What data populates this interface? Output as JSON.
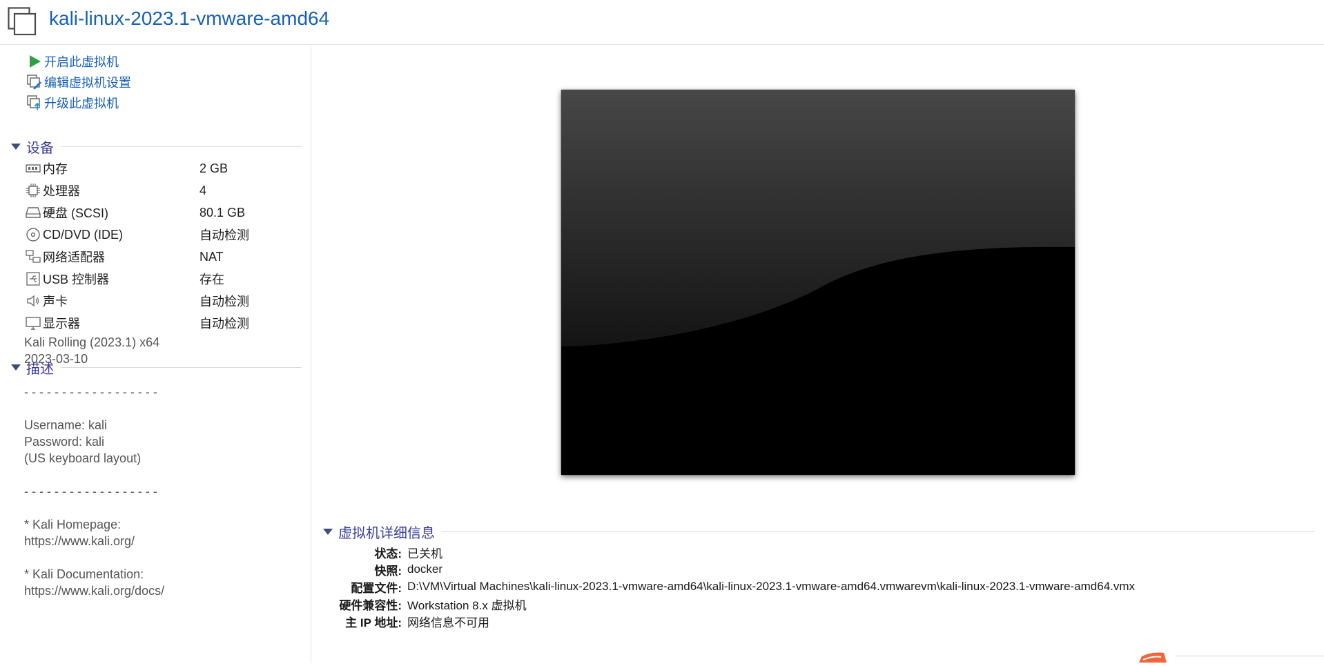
{
  "window": {
    "title": "kali-linux-2023.1-vmware-amd64"
  },
  "actions": [
    {
      "label": "开启此虚拟机",
      "icon": "power-on-icon"
    },
    {
      "label": "编辑虚拟机设置",
      "icon": "edit-settings-icon"
    },
    {
      "label": "升级此虚拟机",
      "icon": "upgrade-vm-icon"
    }
  ],
  "devices": {
    "title": "设备",
    "items": [
      {
        "name": "内存",
        "value": "2 GB",
        "icon": "memory-icon"
      },
      {
        "name": "处理器",
        "value": "4",
        "icon": "cpu-icon"
      },
      {
        "name": "硬盘 (SCSI)",
        "value": "80.1 GB",
        "icon": "hard-disk-icon"
      },
      {
        "name": "CD/DVD (IDE)",
        "value": "自动检测",
        "icon": "cd-dvd-icon"
      },
      {
        "name": "网络适配器",
        "value": "NAT",
        "icon": "network-adapter-icon"
      },
      {
        "name": "USB 控制器",
        "value": "存在",
        "icon": "usb-icon"
      },
      {
        "name": "声卡",
        "value": "自动检测",
        "icon": "speaker-icon"
      },
      {
        "name": "显示器",
        "value": "自动检测",
        "icon": "monitor-icon"
      }
    ]
  },
  "description": {
    "title": "描述",
    "text": "Kali Rolling (2023.1) x64\n2023-03-10\n\n- - - - - - - - - - - - - - - - - -\n\nUsername: kali\nPassword: kali\n(US keyboard layout)\n\n- - - - - - - - - - - - - - - - - -\n\n* Kali Homepage:\nhttps://www.kali.org/\n\n* Kali Documentation:\nhttps://www.kali.org/docs/"
  },
  "details": {
    "title": "虚拟机详细信息",
    "rows": [
      {
        "key": "状态:",
        "value": "已关机"
      },
      {
        "key": "快照:",
        "value": "docker"
      },
      {
        "key": "配置文件:",
        "value": "D:\\VM\\Virtual Machines\\kali-linux-2023.1-vmware-amd64\\kali-linux-2023.1-vmware-amd64.vmwarevm\\kali-linux-2023.1-vmware-amd64.vmx"
      },
      {
        "key": "硬件兼容性:",
        "value": "Workstation 8.x 虚拟机"
      },
      {
        "key": "主 IP 地址:",
        "value": "网络信息不可用"
      }
    ]
  },
  "colors": {
    "accent_link": "#1660b8",
    "section_title": "#3a3e9c",
    "power_green": "#2ea043"
  }
}
